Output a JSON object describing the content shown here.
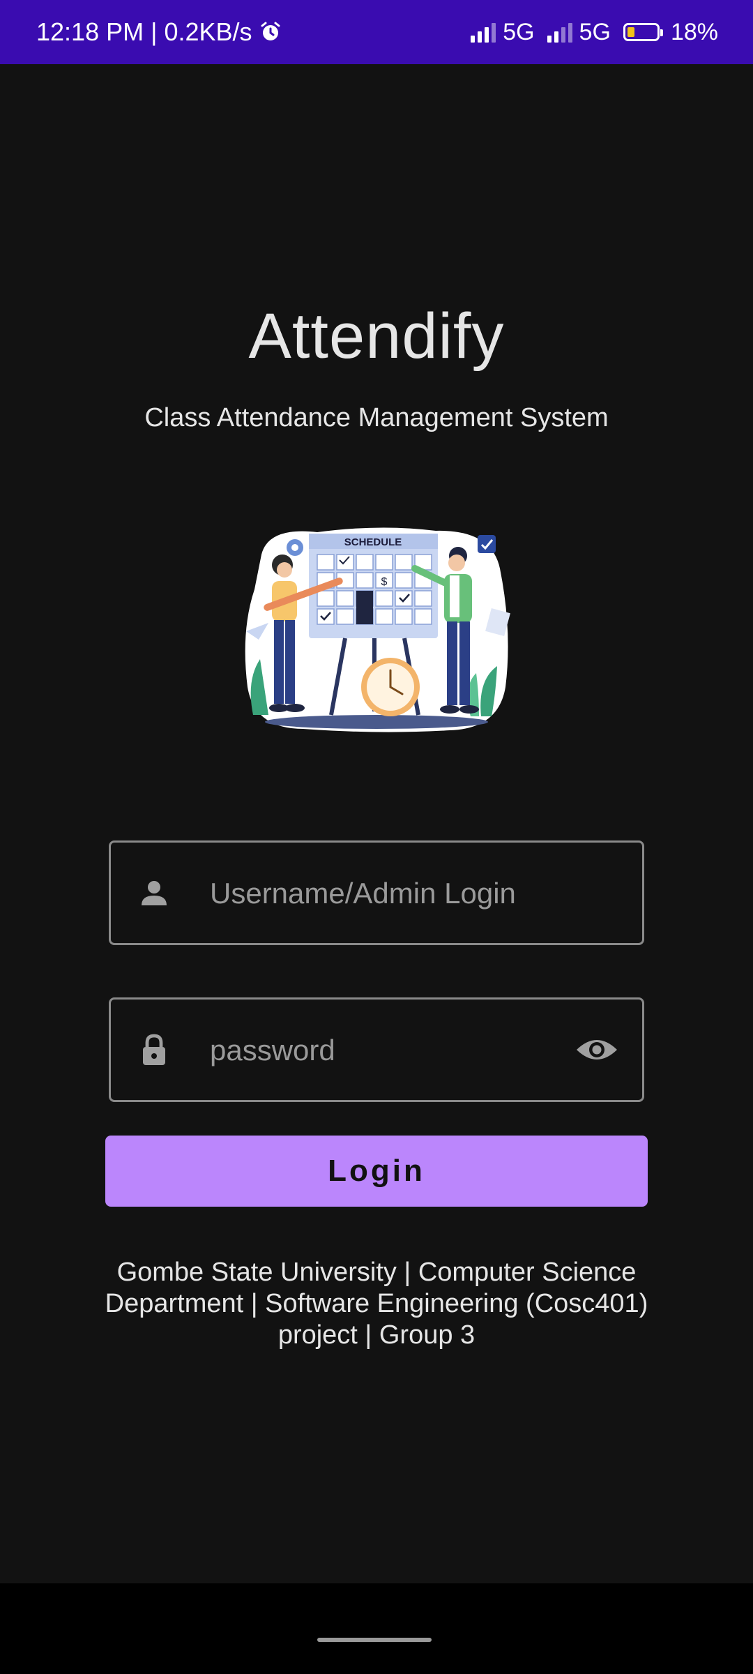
{
  "status_bar": {
    "time_info": "12:18 PM | 0.2KB/s",
    "network_1": "5G",
    "network_2": "5G",
    "battery": "18%"
  },
  "app": {
    "title": "Attendify",
    "subtitle": "Class Attendance Management System"
  },
  "illustration": {
    "board_label": "SCHEDULE"
  },
  "form": {
    "username_placeholder": "Username/Admin Login",
    "password_placeholder": "password",
    "login_label": "Login"
  },
  "footer": {
    "text": "Gombe State University | Computer Science Department | Software Engineering (Cosc401) project | Group 3"
  },
  "colors": {
    "status_bar": "#3a0cb0",
    "background": "#121212",
    "accent": "#bb86fc"
  },
  "icons": [
    "alarm-icon",
    "signal-icon",
    "battery-icon",
    "person-icon",
    "lock-icon",
    "eye-icon"
  ]
}
